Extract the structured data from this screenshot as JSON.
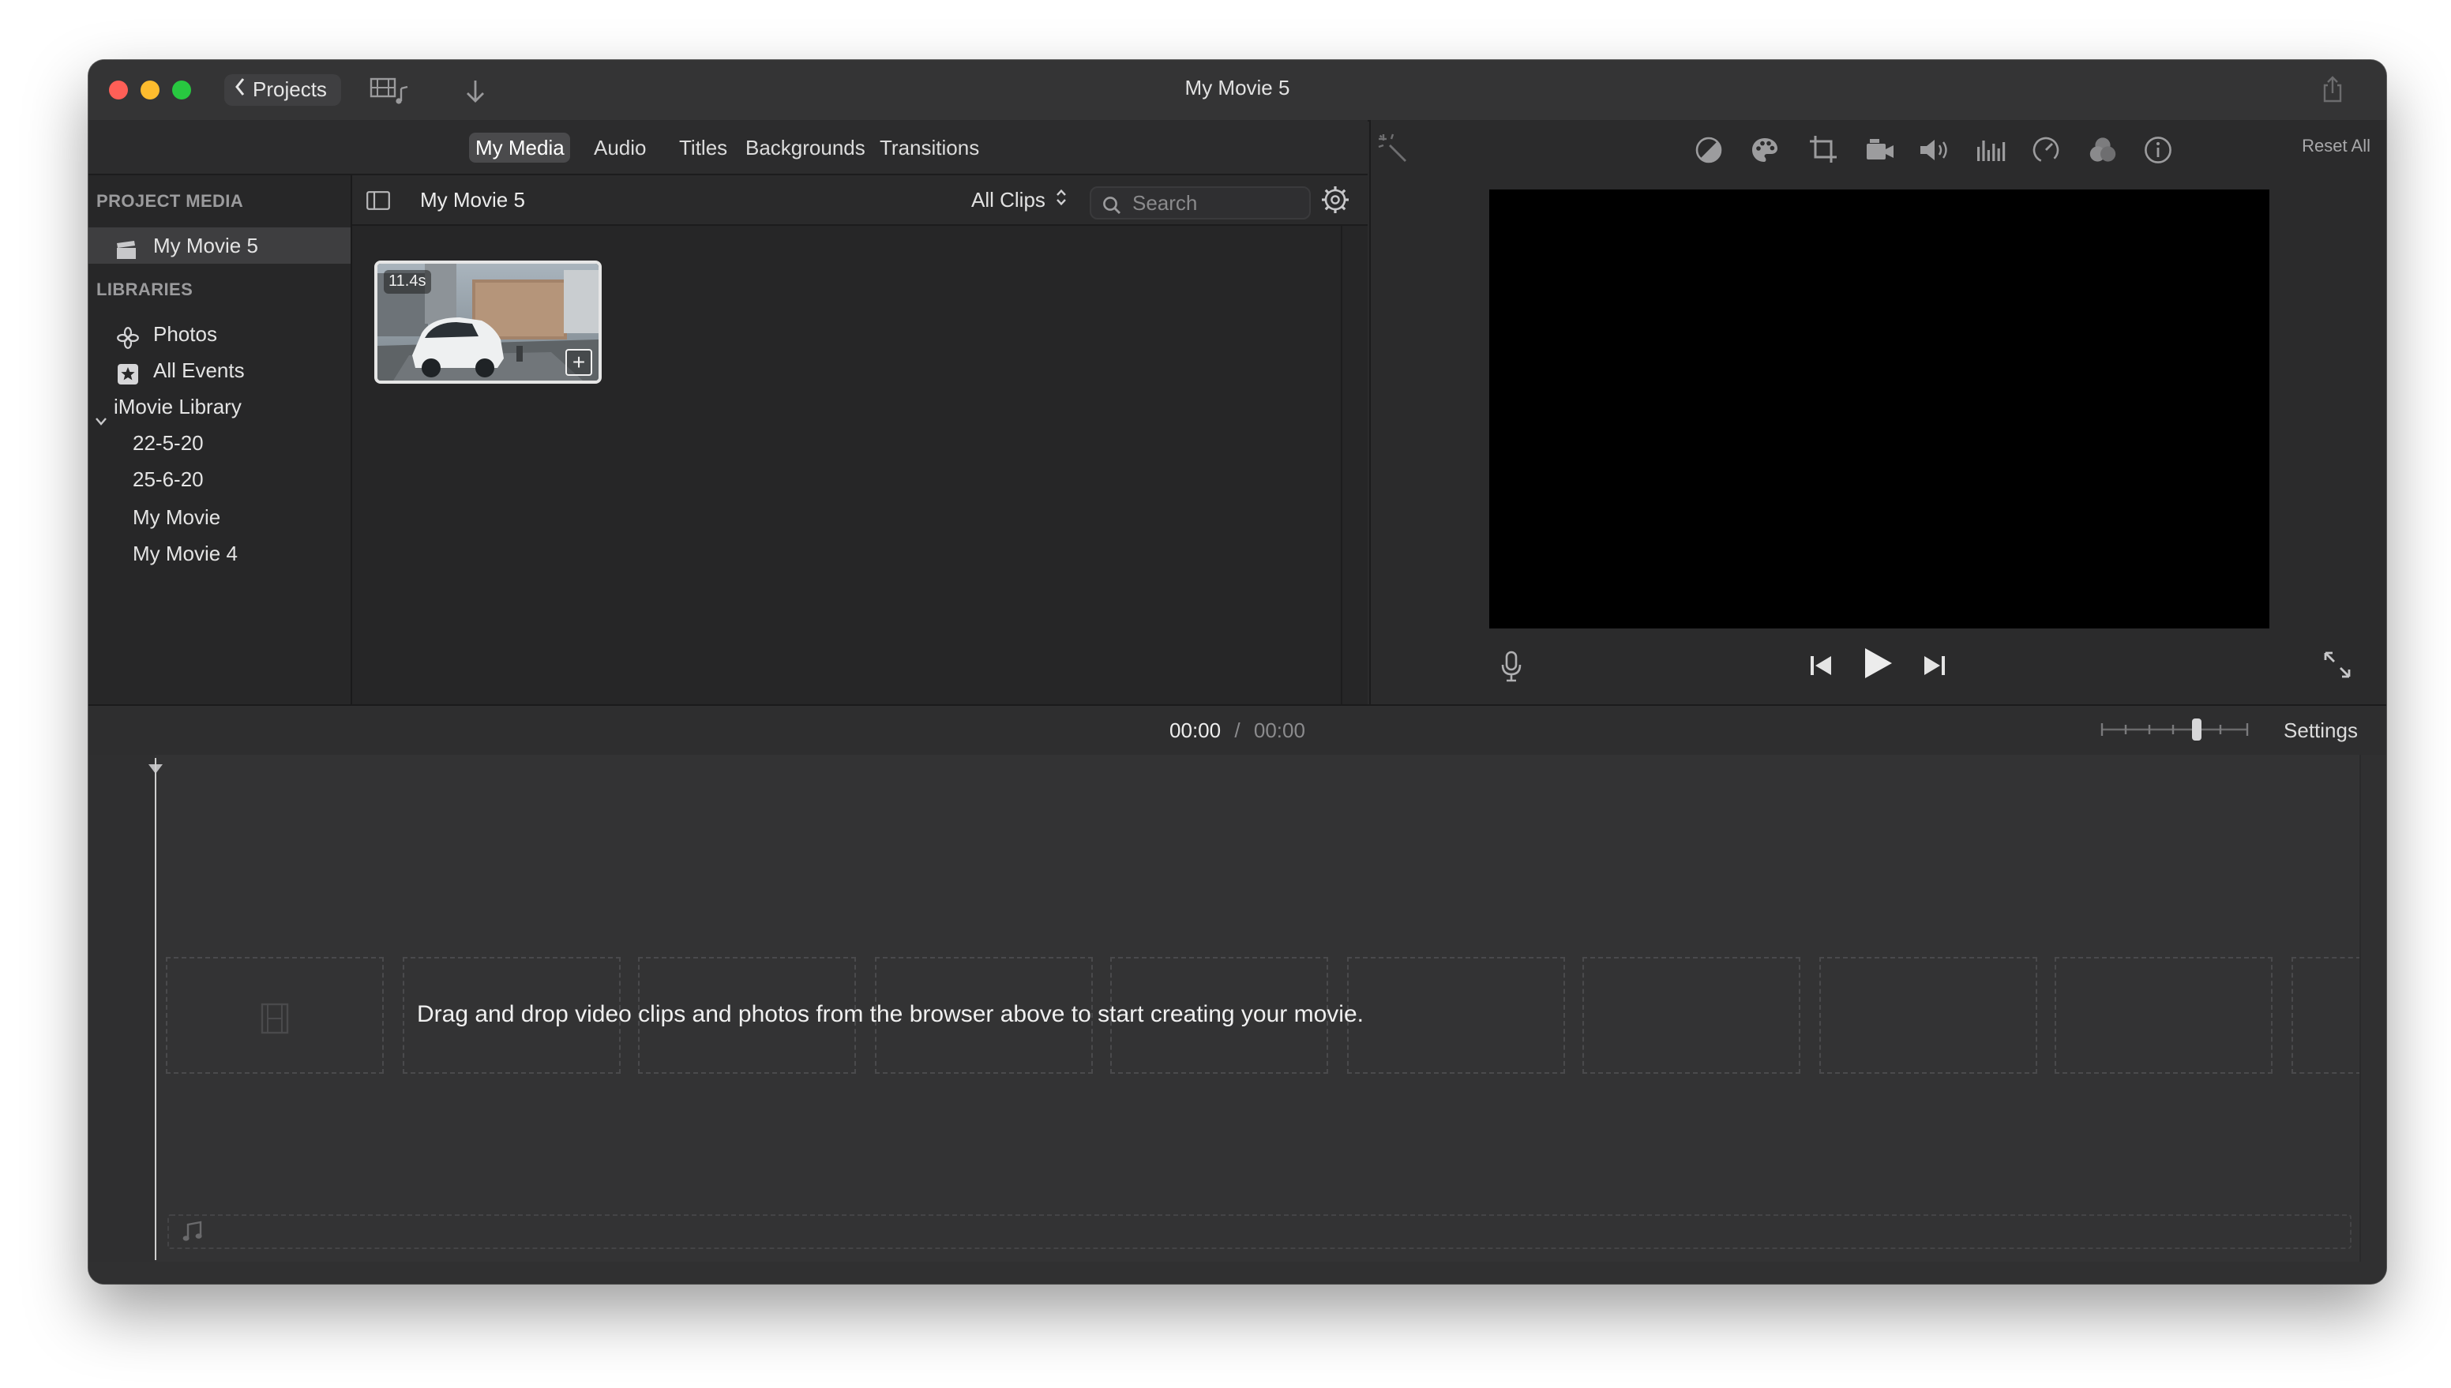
{
  "window": {
    "title": "My Movie 5",
    "back_button_label": "Projects"
  },
  "tabs": [
    {
      "label": "My Media",
      "active": true
    },
    {
      "label": "Audio",
      "active": false
    },
    {
      "label": "Titles",
      "active": false
    },
    {
      "label": "Backgrounds",
      "active": false
    },
    {
      "label": "Transitions",
      "active": false
    }
  ],
  "sidebar": {
    "project_media_heading": "PROJECT MEDIA",
    "project_item": "My Movie 5",
    "libraries_heading": "LIBRARIES",
    "items": [
      {
        "label": "Photos",
        "icon": "photos-icon"
      },
      {
        "label": "All Events",
        "icon": "star-icon"
      }
    ],
    "library": {
      "label": "iMovie Library",
      "events": [
        "22-5-20",
        "25-6-20",
        "My Movie",
        "My Movie 4"
      ]
    }
  },
  "browser": {
    "title": "My Movie 5",
    "filter": "All Clips",
    "search_placeholder": "Search",
    "clips": [
      {
        "duration": "11.4s"
      }
    ]
  },
  "viewer": {
    "reset_label": "Reset All"
  },
  "timeline": {
    "current_time": "00:00",
    "separator": "/",
    "total_time": "00:00",
    "settings_label": "Settings",
    "drop_message": "Drag and drop video clips and photos from the browser above to start creating your movie."
  },
  "colors": {
    "window_bg": "#2b2b2c",
    "accent_selected": "#3e3e40",
    "traffic_red": "#ff5f57",
    "traffic_yellow": "#febc2e",
    "traffic_green": "#28c840"
  }
}
